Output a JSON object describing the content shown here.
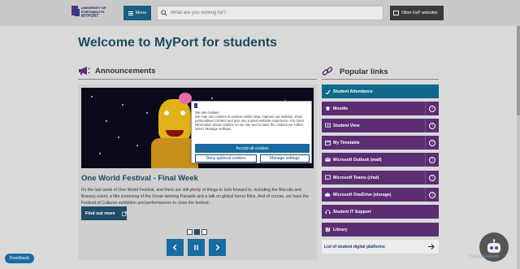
{
  "header": {
    "logo_lines": [
      "UNIVERSITY OF",
      "PORTSMOUTH",
      "MYPORT"
    ],
    "menu_label": "Menu",
    "search_placeholder": "What are you looking for?",
    "other_sites_label": "Other UoP websites"
  },
  "page_title": "Welcome to MyPort for students",
  "announcements": {
    "heading": "Announcements",
    "slide_title": "One World Festival - Final Week",
    "slide_text": "It's the last week of One World Festival, and there are still plenty of things to look forward to, including the Biscuits and Bravery event, a film screening of the Oscar-winning Parasite and a talk on global horror films. And of course, we have the Festival of Cultures exhibition and performances to close the festival.",
    "find_out_more": "Find out more",
    "slide_count": 3,
    "active_slide": 2
  },
  "popular_links": {
    "heading": "Popular links",
    "items": [
      {
        "label": "Student Attendance",
        "icon": "attendance-icon",
        "style": "teal",
        "info": false
      },
      {
        "label": "Moodle",
        "icon": "moodle-icon",
        "style": "purple",
        "info": true
      },
      {
        "label": "Student View",
        "icon": "student-view-icon",
        "style": "purple",
        "info": true
      },
      {
        "label": "My Timetable",
        "icon": "calendar-icon",
        "style": "purple",
        "info": true
      },
      {
        "label": "Microsoft Outlook (mail)",
        "icon": "mail-icon",
        "style": "purple",
        "info": true
      },
      {
        "label": "Microsoft Teams (chat)",
        "icon": "teams-icon",
        "style": "purple",
        "info": true
      },
      {
        "label": "Microsoft OneDrive (storage)",
        "icon": "cloud-icon",
        "style": "purple",
        "info": true
      },
      {
        "label": "Student IT Support",
        "icon": "headset-icon",
        "style": "purple",
        "info": false
      },
      {
        "label": "Library",
        "icon": "library-icon",
        "style": "purple",
        "info": false
      }
    ],
    "digital_platforms_label": "List of student digital platforms"
  },
  "cookie_banner": {
    "heading": "We use cookies",
    "text": "We may use cookies to analyse visitor data, improve our website, show personalised content and give you a great website experience. For more information about cookies on our site and to tailor the cookies we collect, select 'Manage settings'.",
    "accept_label": "Accept all cookies",
    "deny_label": "Deny optional cookies",
    "manage_label": "Manage settings"
  },
  "feedback_label": "Feedback",
  "watermark_text": "ScreenAware",
  "colors": {
    "brand_dark": "#1c4a60",
    "teal": "#0f6a8a",
    "purple": "#5b2d73",
    "button_blue": "#1a6ba0"
  }
}
